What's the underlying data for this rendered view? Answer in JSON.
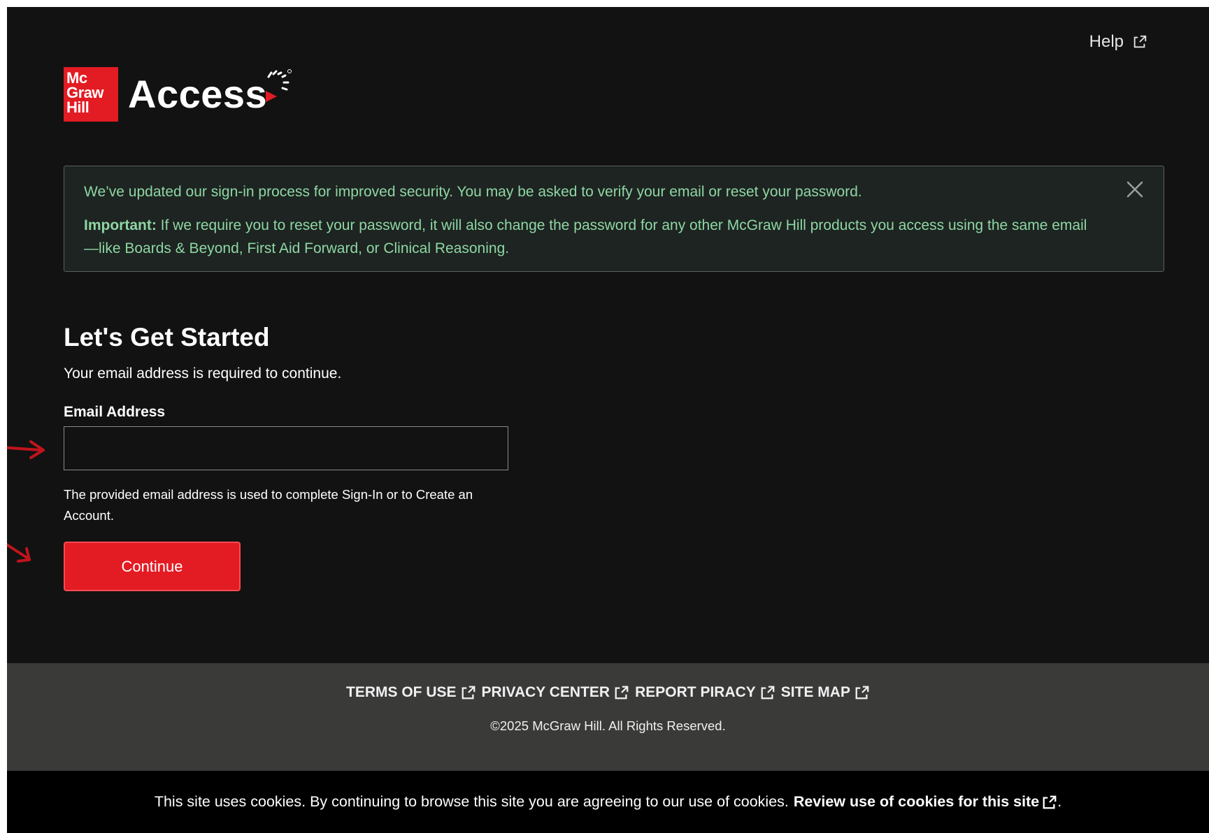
{
  "header": {
    "help_label": "Help",
    "logo_mark_lines": [
      "Mc",
      "Graw",
      "Hill"
    ],
    "logo_product": "Access"
  },
  "banner": {
    "message": "We’ve updated our sign-in process for improved security. You may be asked to verify your email or reset your password.",
    "important_label": "Important:",
    "important_text": " If we require you to reset your password, it will also change the password for any other McGraw Hill products you access using the same email—like Boards & Beyond, First Aid Forward, or Clinical Reasoning."
  },
  "form": {
    "heading": "Let's Get Started",
    "subtext": "Your email address is required to continue.",
    "email_label": "Email Address",
    "email_value": "",
    "helper_text": "The provided email address is used to complete Sign-In or to Create an Account.",
    "continue_label": "Continue"
  },
  "footer": {
    "links": [
      "TERMS OF USE",
      "PRIVACY CENTER",
      "REPORT PIRACY",
      "SITE MAP"
    ],
    "copyright": "©2025 McGraw Hill. All Rights Reserved."
  },
  "cookie": {
    "text": "This site uses cookies. By continuing to browse this site you are agreeing to our use of cookies.",
    "link_label": "Review use of cookies for this site",
    "trailing": "."
  },
  "colors": {
    "brand_red": "#e31b23",
    "banner_text": "#8fd6a5",
    "background": "#121212",
    "footer_bg": "#3a3b39",
    "annotation_arrow": "#c0141c"
  },
  "icons": {
    "external": "external-link-icon",
    "close": "close-icon",
    "arrow": "arrow-annotation-icon"
  }
}
